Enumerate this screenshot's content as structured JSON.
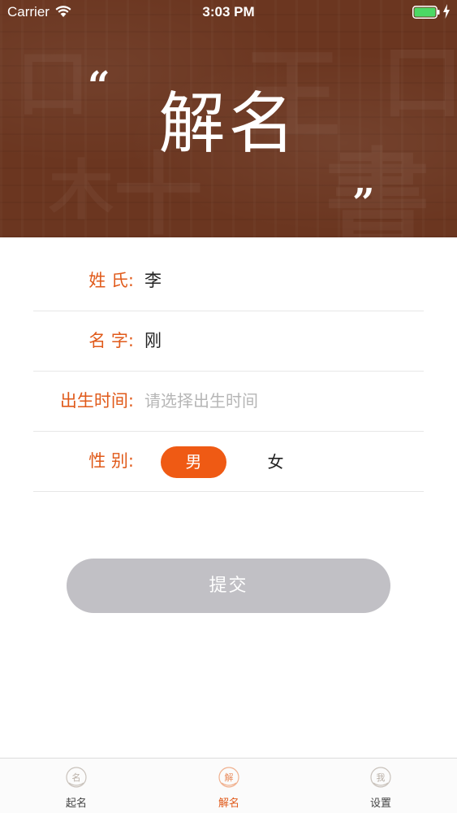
{
  "status_bar": {
    "carrier": "Carrier",
    "time": "3:03 PM",
    "battery_color": "#4cd964"
  },
  "header": {
    "title": "解名",
    "quote_open": "“",
    "quote_close": "”",
    "background_color": "#6b3620"
  },
  "form": {
    "surname": {
      "label": "姓  氏:",
      "value": "李"
    },
    "given_name": {
      "label": "名  字:",
      "value": "刚"
    },
    "birth_time": {
      "label": "出生时间:",
      "placeholder": "请选择出生时间"
    },
    "gender": {
      "label": "性  别:",
      "options": [
        "男",
        "女"
      ],
      "selected": "男"
    }
  },
  "submit": {
    "label": "提交"
  },
  "tab_bar": {
    "accent_color": "#e05a1a",
    "items": [
      {
        "label": "起名",
        "icon": "naming-seal-icon",
        "active": false
      },
      {
        "label": "解名",
        "icon": "interpret-seal-icon",
        "active": true
      },
      {
        "label": "设置",
        "icon": "settings-seal-icon",
        "active": false
      }
    ]
  }
}
